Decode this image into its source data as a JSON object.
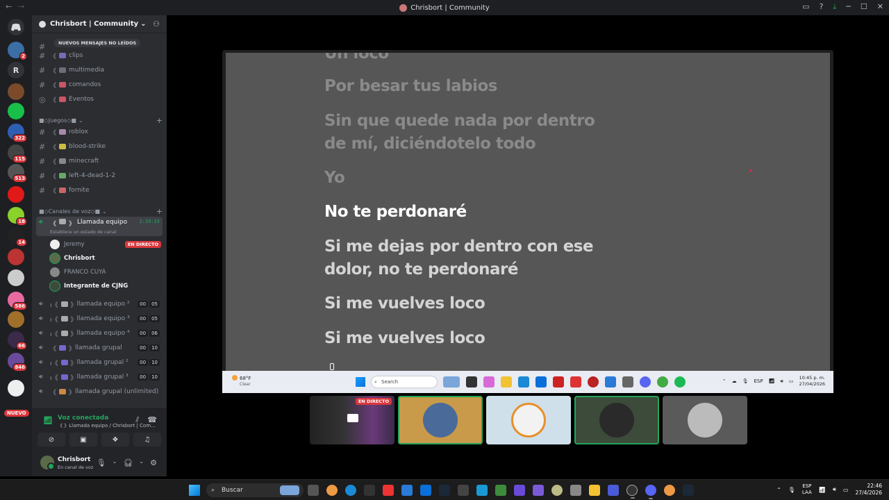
{
  "window": {
    "title": "Chrisbort | Community"
  },
  "server": {
    "name": "Chrisbort | Community"
  },
  "new_messages_pill": "NUEVOS MENSAJES NO LEÍDOS",
  "channels_top": [
    {
      "name": "clips",
      "prefix": "《"
    },
    {
      "name": "multimedia",
      "prefix": "《"
    },
    {
      "name": "comandos",
      "prefix": "《"
    },
    {
      "name": "Eventos",
      "prefix": "《"
    }
  ],
  "category_games": "■◇Juegos◇■",
  "channels_games": [
    {
      "name": "roblox"
    },
    {
      "name": "blood-strike"
    },
    {
      "name": "minecraft"
    },
    {
      "name": "left-4-dead-1-2"
    },
    {
      "name": "fornite"
    }
  ],
  "category_voice": "■◇Canales de voz◇■",
  "active_voice": {
    "name": "Llamada equipo",
    "timer": "2:39:33",
    "status_hint": "Establece un estado de canal"
  },
  "voice_users": [
    {
      "name": "Jeremy",
      "live": "EN DIRECTO"
    },
    {
      "name": "Chrisbort"
    },
    {
      "name": "FRANCO CUYA"
    },
    {
      "name": "Integrante de CJNG"
    }
  ],
  "voice_channels": [
    {
      "name": "llamada equipo ²",
      "a": "00",
      "b": "05"
    },
    {
      "name": "llamada equipo ³",
      "a": "00",
      "b": "05"
    },
    {
      "name": "llamada equipo ⁴",
      "a": "00",
      "b": "06"
    },
    {
      "name": "llamada grupal",
      "a": "00",
      "b": "10"
    },
    {
      "name": "llamada grupal ²",
      "a": "00",
      "b": "10"
    },
    {
      "name": "llamada grupal ³",
      "a": "00",
      "b": "10"
    },
    {
      "name": "llamada grupal (unlimited)"
    }
  ],
  "guild_badges": [
    "2",
    "322",
    "115",
    "513",
    "18",
    "14",
    "586",
    "66",
    "846"
  ],
  "guild_letters": [
    "R"
  ],
  "guild_new": "NUEVO",
  "voice_panel": {
    "title": "Voz conectada",
    "subtitle": "《 》Llamada equipo / Chrisbort | Com..."
  },
  "user_panel": {
    "name": "Chrisbort",
    "status": "En canal de voz"
  },
  "lyrics": [
    {
      "text": "Un loco",
      "state": "past"
    },
    {
      "text": "Por besar tus labios",
      "state": "past"
    },
    {
      "text": "Sin que quede nada por dentro de mí, diciéndotelo todo",
      "state": "past"
    },
    {
      "text": "Yo",
      "state": "past"
    },
    {
      "text": "No te perdonaré",
      "state": "current"
    },
    {
      "text": "Si me dejas por dentro con ese dolor, no te perdonaré",
      "state": "next"
    },
    {
      "text": "Si me vuelves loco",
      "state": "next"
    },
    {
      "text": "Si me vuelves loco",
      "state": "next"
    }
  ],
  "shared_taskbar": {
    "weather_temp": "68°F",
    "weather_desc": "Clear",
    "search": "Search",
    "lang": "ESP",
    "time": "10:45 p. m.",
    "date": "27/04/2026"
  },
  "tiles": [
    {
      "type": "stream",
      "live": "EN DIRECTO"
    },
    {
      "type": "avatar",
      "speaking": true,
      "color": "#c89a4a"
    },
    {
      "type": "avatar",
      "speaking": false,
      "color": "#cfe0ea"
    },
    {
      "type": "avatar",
      "speaking": true,
      "color": "#3c4b3a"
    },
    {
      "type": "avatar",
      "speaking": false,
      "color": "#5a5a5a"
    }
  ],
  "taskbar": {
    "search": "Buscar",
    "lang_top": "ESP",
    "lang_bottom": "LAA",
    "time": "22:46",
    "date": "27/4/2026"
  },
  "colors": {
    "green": "#23a55a",
    "red": "#da373c",
    "bg": "#2b2d31"
  }
}
